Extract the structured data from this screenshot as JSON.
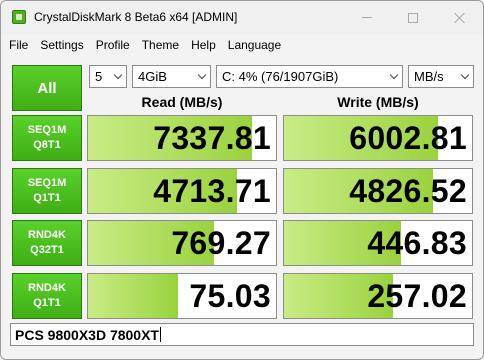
{
  "window": {
    "title": "CrystalDiskMark 8 Beta6 x64 [ADMIN]"
  },
  "menu": [
    "File",
    "Settings",
    "Profile",
    "Theme",
    "Help",
    "Language"
  ],
  "controls": {
    "all_label": "All",
    "count": "5",
    "size": "4GiB",
    "drive": "C: 4% (76/1907GiB)",
    "unit": "MB/s"
  },
  "headers": {
    "read": "Read (MB/s)",
    "write": "Write (MB/s)"
  },
  "tests": [
    {
      "line1": "SEQ1M",
      "line2": "Q8T1",
      "read": "7337.81",
      "write": "6002.81",
      "read_fill": 0.87,
      "write_fill": 0.82
    },
    {
      "line1": "SEQ1M",
      "line2": "Q1T1",
      "read": "4713.71",
      "write": "4826.52",
      "read_fill": 0.79,
      "write_fill": 0.79
    },
    {
      "line1": "RND4K",
      "line2": "Q32T1",
      "read": "769.27",
      "write": "446.83",
      "read_fill": 0.67,
      "write_fill": 0.62
    },
    {
      "line1": "RND4K",
      "line2": "Q1T1",
      "read": "75.03",
      "write": "257.02",
      "read_fill": 0.48,
      "write_fill": 0.58
    }
  ],
  "comment": "PCS 9800X3D 7800XT",
  "colors": {
    "accent_green": "#3fae14",
    "bar_fill": "#9ad23e"
  }
}
